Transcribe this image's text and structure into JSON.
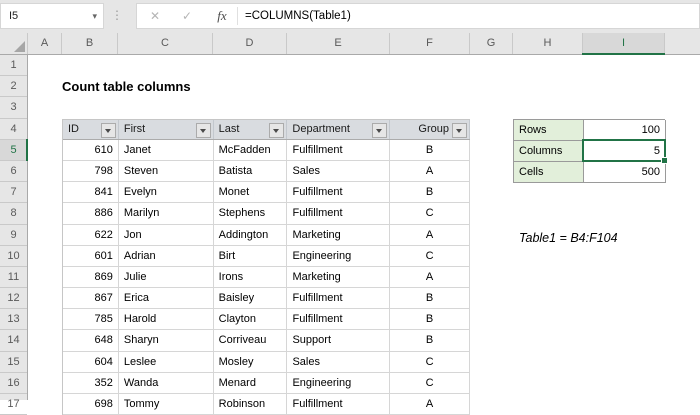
{
  "window": {
    "name_box": "I5",
    "formula": "=COLUMNS(Table1)"
  },
  "formula_bar": {
    "namebox_caret": "▾",
    "separator_dots": "⋮",
    "cancel_icon": "✕",
    "enter_icon": "✓",
    "fx_icon": "fx"
  },
  "grid": {
    "column_letters": [
      "A",
      "B",
      "C",
      "D",
      "E",
      "F",
      "G",
      "H",
      "I"
    ],
    "selected_column": "I",
    "row_numbers": [
      "1",
      "2",
      "3",
      "4",
      "5",
      "6",
      "7",
      "8",
      "9",
      "10",
      "11",
      "12",
      "13",
      "14",
      "15",
      "16",
      "17"
    ],
    "selected_row": "5"
  },
  "sheet": {
    "title": "Count table columns",
    "note": "Table1 = B4:F104"
  },
  "table": {
    "headers": [
      "ID",
      "First",
      "Last",
      "Department",
      "Group"
    ],
    "rows": [
      [
        "610",
        "Janet",
        "McFadden",
        "Fulfillment",
        "B"
      ],
      [
        "798",
        "Steven",
        "Batista",
        "Sales",
        "A"
      ],
      [
        "841",
        "Evelyn",
        "Monet",
        "Fulfillment",
        "B"
      ],
      [
        "886",
        "Marilyn",
        "Stephens",
        "Fulfillment",
        "C"
      ],
      [
        "622",
        "Jon",
        "Addington",
        "Marketing",
        "A"
      ],
      [
        "601",
        "Adrian",
        "Birt",
        "Engineering",
        "C"
      ],
      [
        "869",
        "Julie",
        "Irons",
        "Marketing",
        "A"
      ],
      [
        "867",
        "Erica",
        "Baisley",
        "Fulfillment",
        "B"
      ],
      [
        "785",
        "Harold",
        "Clayton",
        "Fulfillment",
        "B"
      ],
      [
        "648",
        "Sharyn",
        "Corriveau",
        "Support",
        "B"
      ],
      [
        "604",
        "Leslee",
        "Mosley",
        "Sales",
        "C"
      ],
      [
        "352",
        "Wanda",
        "Menard",
        "Engineering",
        "C"
      ],
      [
        "698",
        "Tommy",
        "Robinson",
        "Fulfillment",
        "A"
      ]
    ]
  },
  "summary": {
    "items": [
      {
        "label": "Rows",
        "value": "100"
      },
      {
        "label": "Columns",
        "value": "5"
      },
      {
        "label": "Cells",
        "value": "500"
      }
    ]
  },
  "colors": {
    "accent_green": "#217346",
    "label_fill": "#E2EFDA"
  }
}
